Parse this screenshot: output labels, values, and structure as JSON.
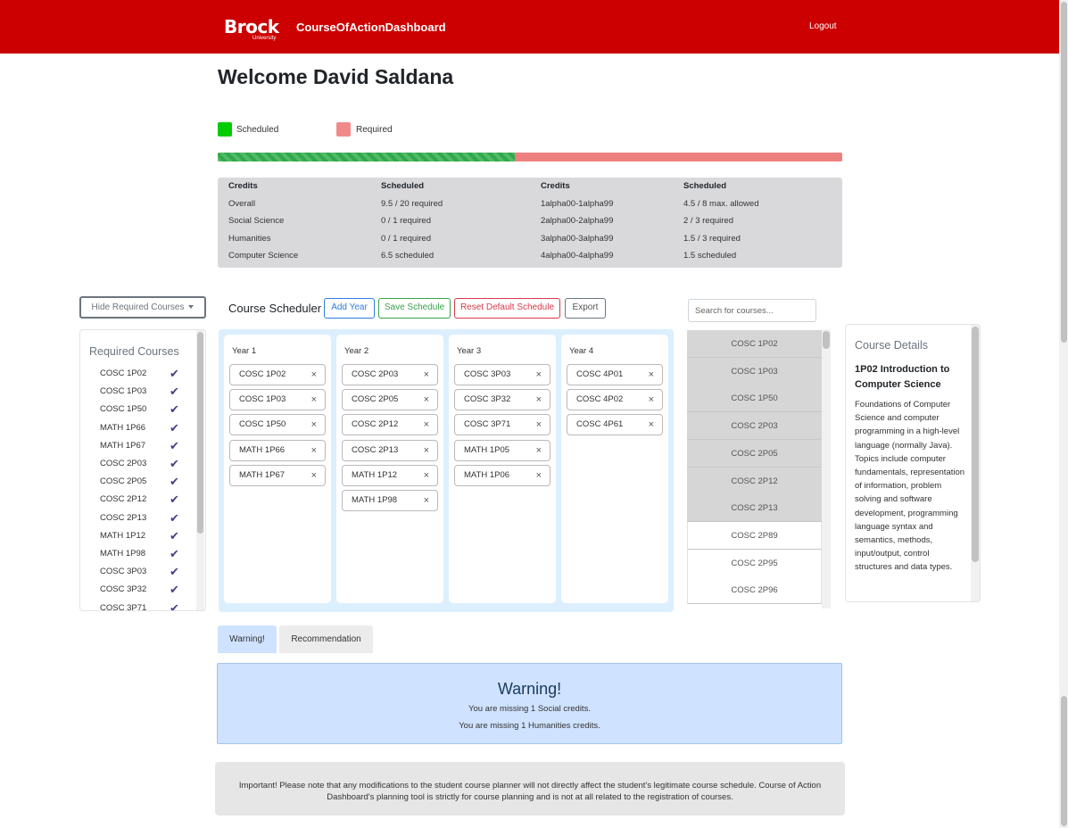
{
  "header": {
    "logo_text": "Brock",
    "logo_sub": "University",
    "app_title": "CourseOfActionDashboard",
    "logout_label": "Logout",
    "bg_color": "#cc0000"
  },
  "welcome": "Welcome David Saldana",
  "legend": {
    "scheduled_label": "Scheduled",
    "scheduled_color": "#00cc00",
    "required_label": "Required",
    "required_color": "#f08a8a"
  },
  "progress": {
    "scheduled_fraction": 0.475
  },
  "credits": {
    "left_headers": [
      "Credits",
      "Scheduled"
    ],
    "left_rows": [
      [
        "Overall",
        "9.5 / 20 required"
      ],
      [
        "Social Science",
        "0 / 1 required"
      ],
      [
        "Humanities",
        "0 / 1 required"
      ],
      [
        "Computer Science",
        "6.5 scheduled"
      ]
    ],
    "right_headers": [
      "Credits",
      "Scheduled"
    ],
    "right_rows": [
      [
        "1alpha00-1alpha99",
        "4.5 / 8 max. allowed"
      ],
      [
        "2alpha00-2alpha99",
        "2 / 3 required"
      ],
      [
        "3alpha00-3alpha99",
        "1.5 / 3 required"
      ],
      [
        "4alpha00-4alpha99",
        "1.5 scheduled"
      ]
    ]
  },
  "sidebar": {
    "toggle_label": "Hide Required Courses",
    "title": "Required Courses",
    "items": [
      "COSC 1P02",
      "COSC 1P03",
      "COSC 1P50",
      "MATH 1P66",
      "MATH 1P67",
      "COSC 2P03",
      "COSC 2P05",
      "COSC 2P12",
      "COSC 2P13",
      "MATH 1P12",
      "MATH 1P98",
      "COSC 3P03",
      "COSC 3P32",
      "COSC 3P71"
    ],
    "check_glyph": "✔"
  },
  "scheduler": {
    "title": "Course Scheduler",
    "add_year": "Add Year",
    "save": "Save Schedule",
    "reset": "Reset Default Schedule",
    "export": "Export",
    "remove_glyph": "×",
    "years": [
      {
        "label": "Year 1",
        "courses": [
          "COSC 1P02",
          "COSC 1P03",
          "COSC 1P50",
          "MATH 1P66",
          "MATH 1P67"
        ]
      },
      {
        "label": "Year 2",
        "courses": [
          "COSC 2P03",
          "COSC 2P05",
          "COSC 2P12",
          "COSC 2P13",
          "MATH 1P12",
          "MATH 1P98"
        ]
      },
      {
        "label": "Year 3",
        "courses": [
          "COSC 3P03",
          "COSC 3P32",
          "COSC 3P71",
          "MATH 1P05",
          "MATH 1P06"
        ]
      },
      {
        "label": "Year 4",
        "courses": [
          "COSC 4P01",
          "COSC 4P02",
          "COSC 4P61"
        ]
      }
    ]
  },
  "search": {
    "placeholder": "Search for courses..."
  },
  "course_list": [
    {
      "code": "COSC 1P02",
      "scheduled": true
    },
    {
      "code": "COSC 1P03",
      "scheduled": true
    },
    {
      "code": "COSC 1P50",
      "scheduled": true
    },
    {
      "code": "COSC 2P03",
      "scheduled": true
    },
    {
      "code": "COSC 2P05",
      "scheduled": true
    },
    {
      "code": "COSC 2P12",
      "scheduled": true
    },
    {
      "code": "COSC 2P13",
      "scheduled": true
    },
    {
      "code": "COSC 2P89",
      "scheduled": false
    },
    {
      "code": "COSC 2P95",
      "scheduled": false
    },
    {
      "code": "COSC 2P96",
      "scheduled": false
    }
  ],
  "details": {
    "title": "Course Details",
    "course": "1P02 Introduction to Computer Science",
    "description": "Foundations of Computer Science and computer programming in a high-level language (normally Java). Topics include computer fundamentals, representation of information, problem solving and software development, programming language syntax and semantics, methods, input/output, control structures and data types."
  },
  "tabs": {
    "warning": "Warning!",
    "recommendation": "Recommendation"
  },
  "alert": {
    "title": "Warning!",
    "lines": [
      "You are missing 1 Social credits.",
      "You are missing 1 Humanities credits."
    ]
  },
  "notice": "Important! Please note that any modifications to the student course planner will not directly affect the student's legitimate course schedule. Course of Action Dashboard's planning tool is strictly for course planning and is not at all related to the registration of courses."
}
